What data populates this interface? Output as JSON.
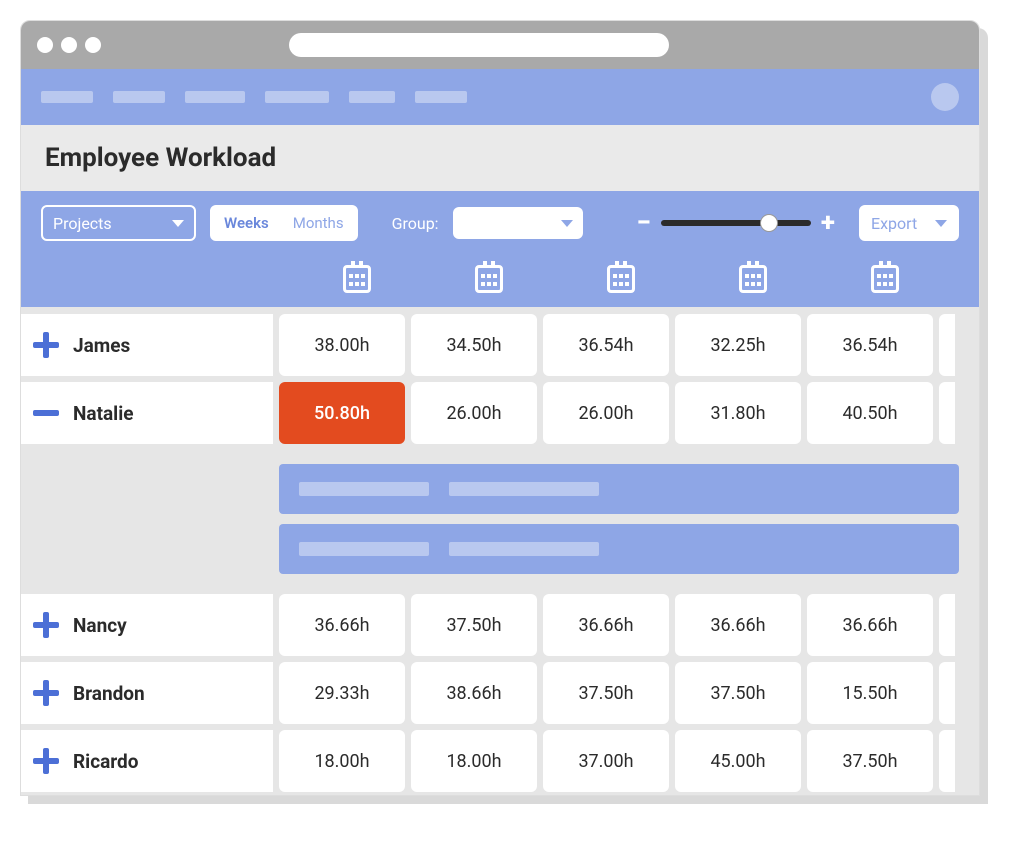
{
  "page": {
    "title": "Employee Workload"
  },
  "toolbar": {
    "projects_label": "Projects",
    "view_weeks": "Weeks",
    "view_months": "Months",
    "group_label": "Group:",
    "export_label": "Export"
  },
  "employees": [
    {
      "name": "James",
      "expanded": false,
      "values": [
        "38.00h",
        "34.50h",
        "36.54h",
        "32.25h",
        "36.54h"
      ]
    },
    {
      "name": "Natalie",
      "expanded": true,
      "values": [
        "50.80h",
        "26.00h",
        "26.00h",
        "31.80h",
        "40.50h"
      ],
      "alert_index": 0
    },
    {
      "name": "Nancy",
      "expanded": false,
      "values": [
        "36.66h",
        "37.50h",
        "36.66h",
        "36.66h",
        "36.66h"
      ]
    },
    {
      "name": "Brandon",
      "expanded": false,
      "values": [
        "29.33h",
        "38.66h",
        "37.50h",
        "37.50h",
        "15.50h"
      ]
    },
    {
      "name": "Ricardo",
      "expanded": false,
      "values": [
        "18.00h",
        "18.00h",
        "37.00h",
        "45.00h",
        "37.50h"
      ]
    }
  ]
}
